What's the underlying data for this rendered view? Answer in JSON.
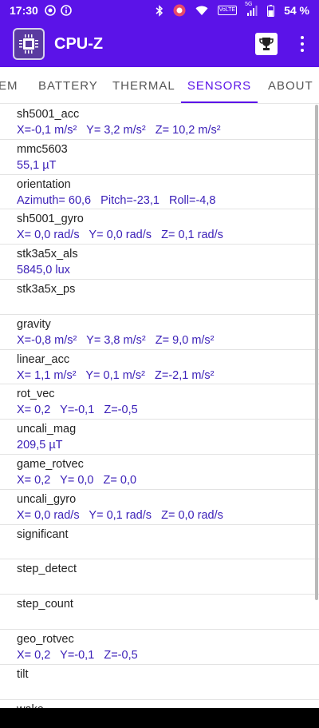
{
  "status_bar": {
    "time": "17:30",
    "battery_percent": "54 %",
    "network_label": "5G",
    "volte_label": "VoLTE"
  },
  "app": {
    "title": "CPU-Z"
  },
  "tabs": [
    {
      "label": "EM",
      "active": false
    },
    {
      "label": "BATTERY",
      "active": false
    },
    {
      "label": "THERMAL",
      "active": false
    },
    {
      "label": "SENSORS",
      "active": true
    },
    {
      "label": "ABOUT",
      "active": false
    }
  ],
  "sensors": [
    {
      "name": "sh5001_acc",
      "value": "X=-0,1 m/s²   Y= 3,2 m/s²   Z= 10,2 m/s²"
    },
    {
      "name": "mmc5603",
      "value": "55,1 µT"
    },
    {
      "name": "orientation",
      "value": "Azimuth= 60,6   Pitch=-23,1   Roll=-4,8"
    },
    {
      "name": "sh5001_gyro",
      "value": "X= 0,0 rad/s   Y= 0,0 rad/s   Z= 0,1 rad/s"
    },
    {
      "name": "stk3a5x_als",
      "value": "5845,0 lux"
    },
    {
      "name": "stk3a5x_ps",
      "value": ""
    },
    {
      "name": "gravity",
      "value": "X=-0,8 m/s²   Y= 3,8 m/s²   Z= 9,0 m/s²"
    },
    {
      "name": "linear_acc",
      "value": "X= 1,1 m/s²   Y= 0,1 m/s²   Z=-2,1 m/s²"
    },
    {
      "name": "rot_vec",
      "value": "X= 0,2   Y=-0,1   Z=-0,5"
    },
    {
      "name": "uncali_mag",
      "value": "209,5 µT"
    },
    {
      "name": "game_rotvec",
      "value": "X= 0,2   Y= 0,0   Z= 0,0"
    },
    {
      "name": "uncali_gyro",
      "value": "X= 0,0 rad/s   Y= 0,1 rad/s   Z= 0,0 rad/s"
    },
    {
      "name": "significant",
      "value": ""
    },
    {
      "name": "step_detect",
      "value": ""
    },
    {
      "name": "step_count",
      "value": ""
    },
    {
      "name": "geo_rotvec",
      "value": "X= 0,2   Y=-0,1   Z=-0,5"
    },
    {
      "name": "tilt",
      "value": ""
    },
    {
      "name": "wake",
      "value": ""
    }
  ],
  "colors": {
    "brand": "#5b13e8",
    "value_text": "#3a1fb8"
  }
}
